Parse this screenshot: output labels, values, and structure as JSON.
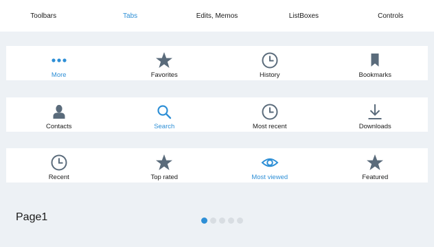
{
  "top_tabs": [
    {
      "label": "Toolbars",
      "active": false
    },
    {
      "label": "Tabs",
      "active": true
    },
    {
      "label": "Edits, Memos",
      "active": false
    },
    {
      "label": "ListBoxes",
      "active": false
    },
    {
      "label": "Controls",
      "active": false
    }
  ],
  "tabbars": [
    [
      {
        "label": "More",
        "icon": "more-icon",
        "active": true
      },
      {
        "label": "Favorites",
        "icon": "star-icon",
        "active": false
      },
      {
        "label": "History",
        "icon": "clock-icon",
        "active": false
      },
      {
        "label": "Bookmarks",
        "icon": "bookmark-icon",
        "active": false
      }
    ],
    [
      {
        "label": "Contacts",
        "icon": "person-icon",
        "active": false
      },
      {
        "label": "Search",
        "icon": "search-icon",
        "active": true
      },
      {
        "label": "Most recent",
        "icon": "clock-icon",
        "active": false
      },
      {
        "label": "Downloads",
        "icon": "download-icon",
        "active": false
      }
    ],
    [
      {
        "label": "Recent",
        "icon": "clock-icon",
        "active": false
      },
      {
        "label": "Top rated",
        "icon": "star-icon",
        "active": false
      },
      {
        "label": "Most viewed",
        "icon": "eye-icon",
        "active": true
      },
      {
        "label": "Featured",
        "icon": "star-icon",
        "active": false
      }
    ]
  ],
  "page": {
    "label": "Page1"
  },
  "pager": {
    "count": 5,
    "active_index": 0
  },
  "colors": {
    "accent": "#2e8fd6",
    "icon": "#5a6b7b",
    "background": "#edf1f5"
  }
}
